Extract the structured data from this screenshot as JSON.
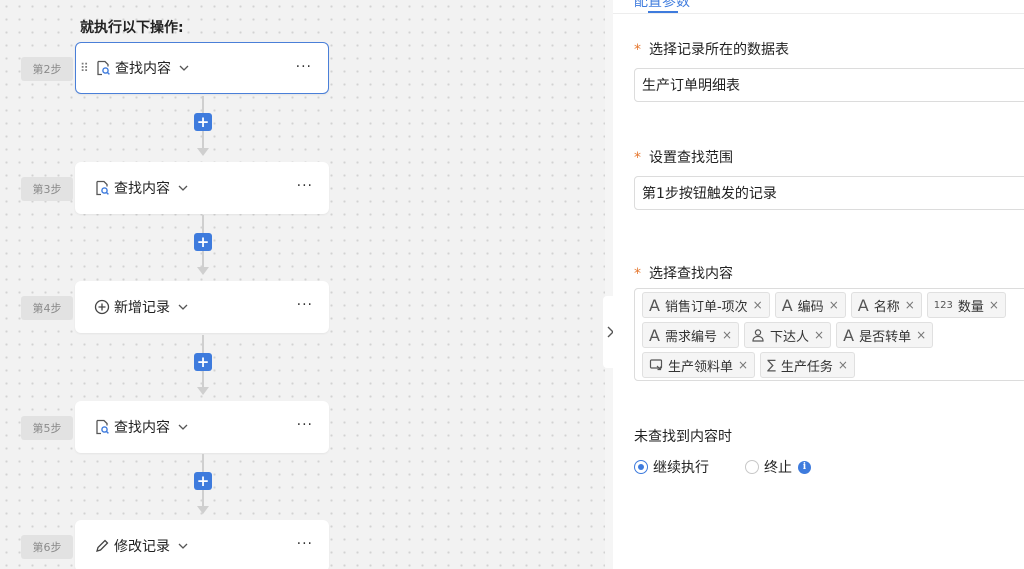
{
  "canvas": {
    "heading": "就执行以下操作:",
    "steps": [
      {
        "badge": "第2步",
        "label": "查找内容",
        "icon": "doc-search-icon",
        "more": "···"
      },
      {
        "badge": "第3步",
        "label": "查找内容",
        "icon": "doc-search-icon",
        "more": "···"
      },
      {
        "badge": "第4步",
        "label": "新增记录",
        "icon": "plus-circle-icon",
        "more": "···"
      },
      {
        "badge": "第5步",
        "label": "查找内容",
        "icon": "doc-search-icon",
        "more": "···"
      },
      {
        "badge": "第6步",
        "label": "修改记录",
        "icon": "pencil-icon",
        "more": "···"
      }
    ],
    "add_symbol": "+",
    "drag_symbol": "⠿",
    "colors": {
      "accent": "#3e7bdd",
      "active_border": "#4a7fd8"
    }
  },
  "panel": {
    "tab": "配置参数",
    "fields": [
      {
        "label": "选择记录所在的数据表",
        "required": "*",
        "value": "生产订单明细表"
      },
      {
        "label": "设置查找范围",
        "required": "*",
        "value": "第1步按钮触发的记录"
      }
    ],
    "content_field": {
      "label": "选择查找内容",
      "required": "*",
      "tags": [
        {
          "icon": "text-icon",
          "glyph": "A",
          "label": "销售订单-项次",
          "close": "×"
        },
        {
          "icon": "text-icon",
          "glyph": "A",
          "label": "编码",
          "close": "×"
        },
        {
          "icon": "text-icon",
          "glyph": "A",
          "label": "名称",
          "close": "×"
        },
        {
          "icon": "number-icon",
          "glyph": "123",
          "label": "数量",
          "close": "×"
        },
        {
          "icon": "text-icon",
          "glyph": "A",
          "label": "需求编号",
          "close": "×"
        },
        {
          "icon": "user-icon",
          "glyph": "",
          "label": "下达人",
          "close": "×"
        },
        {
          "icon": "text-icon",
          "glyph": "A",
          "label": "是否转单",
          "close": "×"
        },
        {
          "icon": "relation-icon",
          "glyph": "",
          "label": "生产领料单",
          "close": "×"
        },
        {
          "icon": "sigma-icon",
          "glyph": "∑",
          "label": "生产任务",
          "close": "×"
        }
      ]
    },
    "not_found": {
      "label": "未查找到内容时",
      "options": [
        {
          "label": "继续执行",
          "checked": true
        },
        {
          "label": "终止",
          "checked": false
        }
      ],
      "info_glyph": "i"
    }
  }
}
